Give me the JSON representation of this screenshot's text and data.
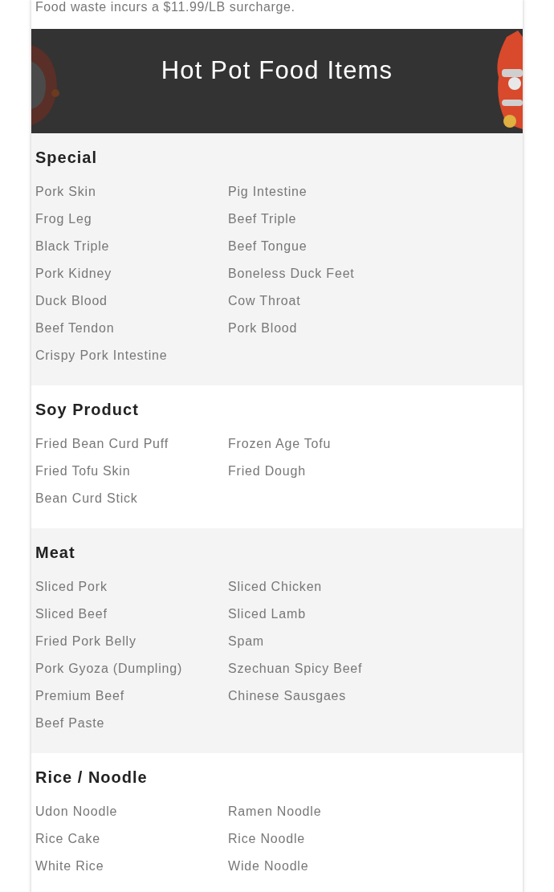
{
  "notice": "Food waste incurs a $11.99/LB surcharge.",
  "banner": {
    "title": "Hot Pot Food Items"
  },
  "sections": [
    {
      "title": "Special",
      "items": [
        "Pork Skin",
        "Pig Intestine",
        "Frog Leg",
        "Beef Triple",
        "Black Triple",
        "Beef Tongue",
        "Pork Kidney",
        "Boneless Duck Feet",
        "Duck Blood",
        "Cow Throat",
        "Beef Tendon",
        "Pork Blood",
        "Crispy Pork Intestine"
      ]
    },
    {
      "title": "Soy Product",
      "items": [
        "Fried Bean Curd Puff",
        "Frozen Age Tofu",
        "Fried Tofu Skin",
        "Fried Dough",
        "Bean Curd Stick"
      ]
    },
    {
      "title": "Meat",
      "items": [
        "Sliced Pork",
        "Sliced Chicken",
        "Sliced Beef",
        "Sliced Lamb",
        "Fried Pork Belly",
        "Spam",
        "Pork Gyoza (Dumpling)",
        "Szechuan Spicy Beef",
        "Premium Beef",
        "Chinese Sausgaes",
        "Beef Paste"
      ]
    },
    {
      "title": "Rice / Noodle",
      "items": [
        "Udon Noodle",
        "Ramen Noodle",
        "Rice Cake",
        "Rice Noodle",
        "White Rice",
        "Wide Noodle"
      ]
    }
  ]
}
